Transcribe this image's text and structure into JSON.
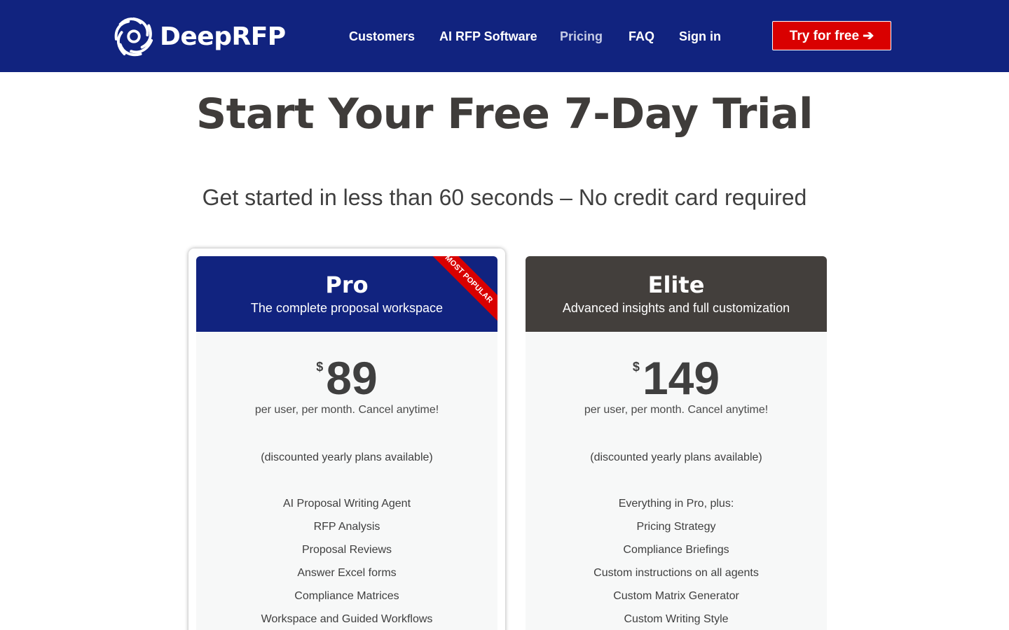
{
  "header": {
    "logo_text": "DeepRFP",
    "logo_icon": "spiral-swirl-icon",
    "nav": [
      {
        "label": "Customers",
        "active": false
      },
      {
        "label": "AI RFP Software",
        "active": false
      },
      {
        "label": "Pricing",
        "active": true
      },
      {
        "label": "FAQ",
        "active": false
      },
      {
        "label": "Sign in",
        "active": false
      }
    ],
    "cta_label": "Try for free ➔"
  },
  "hero": {
    "title": "Start Your Free 7-Day Trial",
    "subtitle": "Get started in less than 60 seconds – No credit card required"
  },
  "plans": [
    {
      "name": "Pro",
      "description": "The complete proposal workspace",
      "ribbon": "MOST POPULAR",
      "currency": "$",
      "price": "89",
      "period": "per user, per month. Cancel anytime!",
      "yearly_note": "(discounted yearly plans available)",
      "features": [
        "AI Proposal Writing Agent",
        "RFP Analysis",
        "Proposal Reviews",
        "Answer Excel forms",
        "Compliance Matrices",
        "Workspace and Guided Workflows"
      ]
    },
    {
      "name": "Elite",
      "description": "Advanced insights and full customization",
      "currency": "$",
      "price": "149",
      "period": "per user, per month. Cancel anytime!",
      "yearly_note": "(discounted yearly plans available)",
      "features": [
        "Everything in Pro, plus:",
        "Pricing Strategy",
        "Compliance Briefings",
        "Custom instructions on all agents",
        "Custom Matrix Generator",
        "Custom Writing Style"
      ]
    }
  ],
  "colors": {
    "header_bg": "#11237f",
    "cta_bg": "#d90000",
    "elite_head_bg": "#433f3c",
    "card_bg": "#f7f8f8",
    "nav_active": "#c5cbe5"
  }
}
